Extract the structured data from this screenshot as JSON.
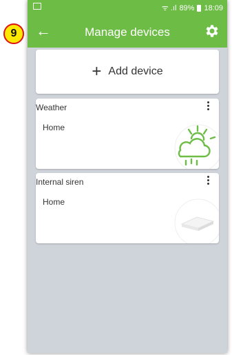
{
  "status_bar": {
    "signal": "ᯤ .ıl",
    "battery": "89%",
    "time": "18:09"
  },
  "app_bar": {
    "title": "Manage devices",
    "back_icon": "←"
  },
  "annotation": {
    "number": "9"
  },
  "add_device": {
    "plus": "+",
    "label": "Add device"
  },
  "devices": [
    {
      "name": "Weather",
      "location": "Home",
      "icon": "weather-cloud-rain-sun-icon"
    },
    {
      "name": "Internal siren",
      "location": "Home",
      "icon": "siren-device-icon"
    }
  ],
  "colors": {
    "accent": "#6cbc45",
    "background": "#cfd4da",
    "badge": "#ffe800",
    "badge_border": "#dd1111"
  }
}
